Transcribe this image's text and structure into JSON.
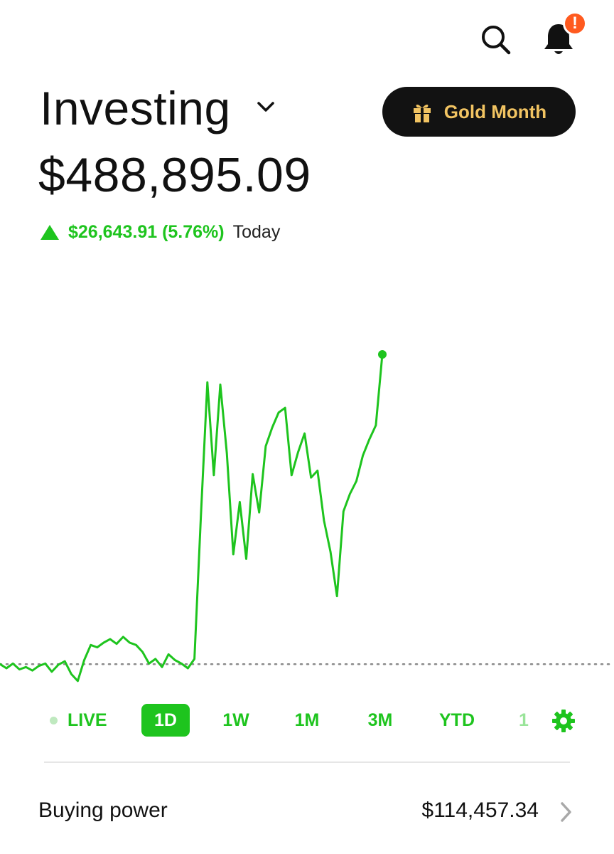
{
  "header": {
    "account_title": "Investing",
    "portfolio_value": "$488,895.09",
    "change_amount": "$26,643.91 (5.76%)",
    "change_period": "Today",
    "gold_button_label": "Gold Month"
  },
  "notifications": {
    "badge": "!"
  },
  "colors": {
    "accent_green": "#1ec41e",
    "gold_text": "#f2c462",
    "badge_orange": "#ff5a1f",
    "button_dark": "#121212"
  },
  "icons": {
    "search": "search-icon",
    "bell": "bell-icon",
    "chevron_down": "chevron-down-icon",
    "gift": "gift-icon",
    "settings": "gear-icon",
    "chevron_right": "chevron-right-icon"
  },
  "ranges": {
    "live": "LIVE",
    "d1": "1D",
    "w1": "1W",
    "m1": "1M",
    "m3": "3M",
    "ytd": "YTD",
    "y1_partial": "1",
    "selected": "1D"
  },
  "buying_power": {
    "label": "Buying power",
    "value": "$114,457.34"
  },
  "chart_data": {
    "type": "line",
    "ylabel": "",
    "xlabel": "",
    "baseline": 462251.18,
    "reference_line": "dotted, previous close",
    "series": [
      {
        "values": [
          462251.18,
          461900,
          462300,
          461800,
          462000,
          461700,
          462100,
          462300,
          461600,
          462200,
          462500,
          461400,
          460800,
          462600,
          463900,
          463700,
          464100,
          464400,
          464000,
          464600,
          464100,
          463900,
          463300,
          462300,
          462700,
          462000,
          463100,
          462600,
          462300,
          461900,
          462700,
          475000,
          486500,
          478500,
          486300,
          480400,
          471700,
          476200,
          471300,
          478600,
          475300,
          481000,
          482600,
          483900,
          484300,
          478500,
          480500,
          482100,
          478300,
          478900,
          474600,
          471900,
          468100,
          475400,
          476900,
          478000,
          480200,
          481600,
          482800,
          488895.09
        ]
      }
    ]
  }
}
